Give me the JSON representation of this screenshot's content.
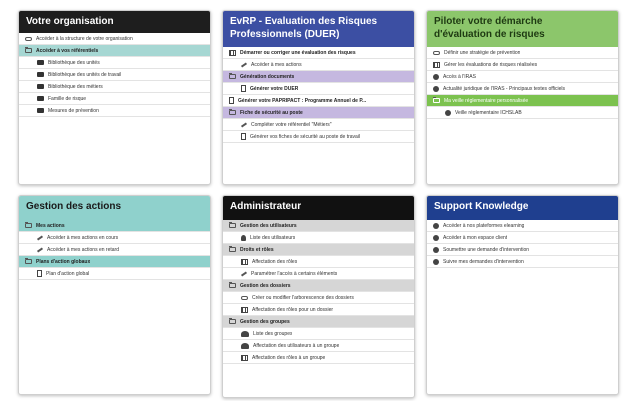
{
  "cards": {
    "org": {
      "title": "Votre organisation",
      "colors": {
        "head_bg": "#1e1e1e",
        "head_fg": "#ffffff"
      },
      "items": [
        "Accéder à la structure de votre organisation",
        "Accéder à vos référentiels",
        "Bibliothèque des unités",
        "Bibliothèque des unités de travail",
        "Bibliothèque des métiers",
        "Famille de risque",
        "Mesures de prévention"
      ]
    },
    "evrp": {
      "title_line1": "EvRP - Evaluation des Risques",
      "title_line2": "Professionnels (DUER)",
      "colors": {
        "head_bg": "#3c4fa3",
        "head_fg": "#ffffff",
        "section_bg": "#c5b8e0"
      },
      "items": [
        "Démarrer ou corriger une évaluation des risques",
        "Accéder à mes actions",
        "Génération documents",
        "Générer votre DUER",
        "Générer votre PAPRIPACT : Programme Annuel de P...",
        "Fiche de sécurité au poste",
        "Compléter votre référentiel \"Métiers\"",
        "Générer vos fiches de sécurité au poste de travail"
      ]
    },
    "pilot": {
      "title_line1": "Piloter votre démarche",
      "title_line2": "d'évaluation de risques",
      "colors": {
        "head_bg": "#8cc66b",
        "head_fg": "#1e3a12",
        "section_bg": "#7cc24f"
      },
      "items": [
        "Définir une stratégie de prévention",
        "Gérer les évaluations de risques réalisées",
        "Accès à l'IRAS",
        "Actualité juridique de l'IRAS - Principaux textes officiels",
        "Ma veille réglementaire personnalisée",
        "Veille réglementaire ICHSLAB"
      ]
    },
    "actions": {
      "title": "Gestion des actions",
      "colors": {
        "head_bg": "#8fd1cc",
        "head_fg": "#1a1a1a",
        "section_bg": "#8fd1cc"
      },
      "items": [
        "Mes actions",
        "Accéder à mes actions en cours",
        "Accéder à mes actions en retard",
        "Plans d'action globaux",
        "Plan d'action global"
      ]
    },
    "admin": {
      "title": "Administrateur",
      "colors": {
        "head_bg": "#111111",
        "head_fg": "#ffffff",
        "section_bg": "#d6d6d6"
      },
      "items": [
        "Gestion des utilisateurs",
        "Liste des utilisateurs",
        "Droits et rôles",
        "Affectation des rôles",
        "Paramétrer l'accès à certains éléments",
        "Gestion des dossiers",
        "Créer ou modifier l'arborescence des dossiers",
        "Affectation des rôles pour un dossier",
        "Gestion des groupes",
        "Liste des groupes",
        "Affectation des utilisateurs à un groupe",
        "Affectation des rôles à un groupe"
      ]
    },
    "support": {
      "title": "Support Knowledge",
      "colors": {
        "head_bg": "#1f3f8f",
        "head_fg": "#ffffff"
      },
      "items": [
        "Accéder à nos plateformes elearning",
        "Accéder à mon espace client",
        "Soumettre une demande d'intervention",
        "Suivre mes demandes d'intervention"
      ]
    }
  }
}
